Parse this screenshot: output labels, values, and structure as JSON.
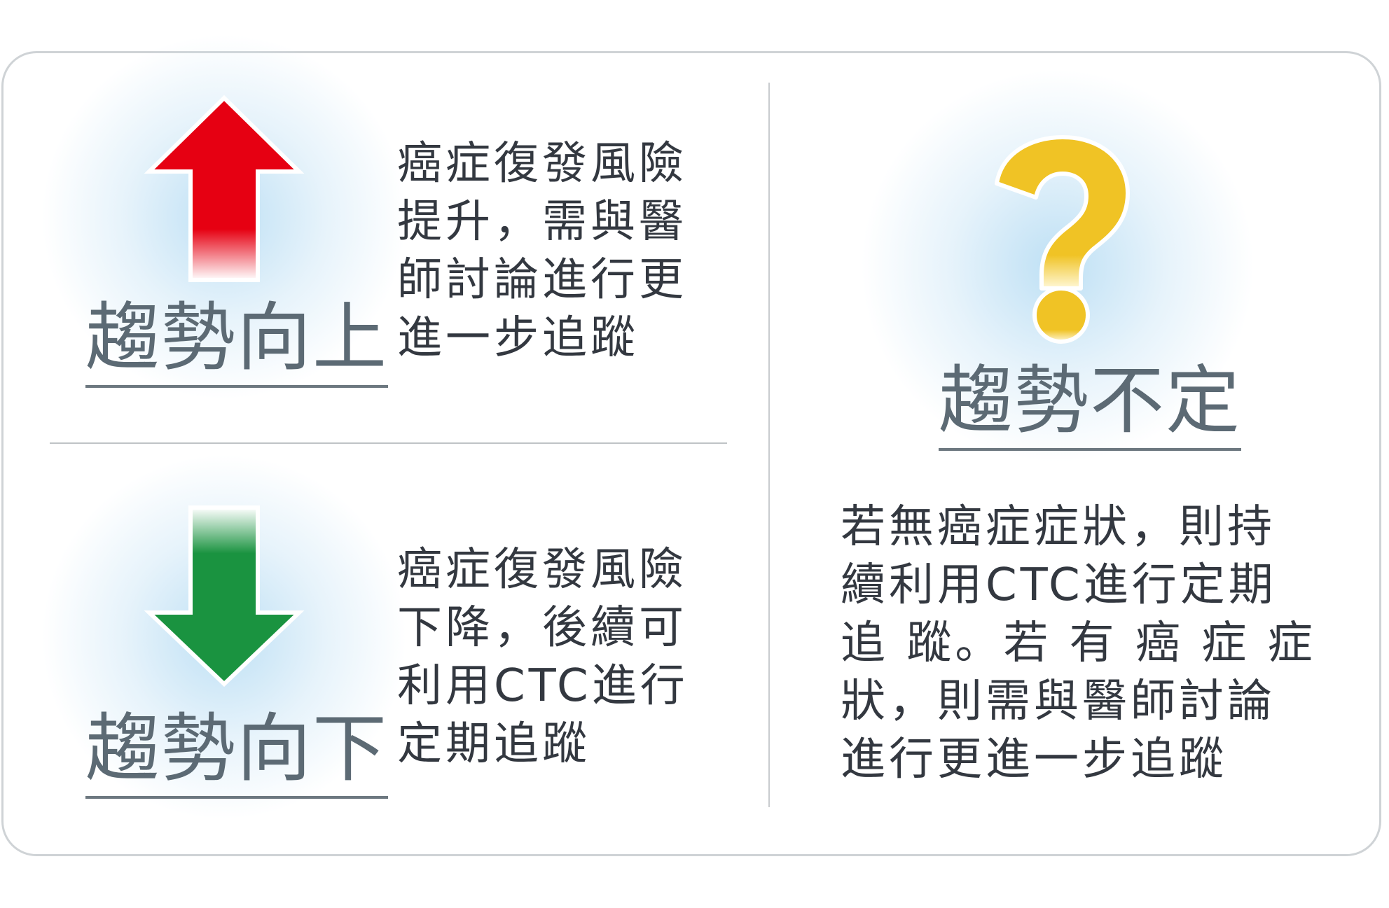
{
  "trend_up": {
    "label": "趨勢向上",
    "icon": "arrow-up-icon",
    "color": "#e60012",
    "description_lines": [
      "癌症復發風險",
      "提升，需與醫",
      "師討論進行更",
      "進一步追蹤"
    ]
  },
  "trend_down": {
    "label": "趨勢向下",
    "icon": "arrow-down-icon",
    "color": "#1a9340",
    "description_lines": [
      "癌症復發風險",
      "下降，後續可",
      "利用CTC進行",
      "定期追蹤"
    ]
  },
  "trend_uncertain": {
    "label": "趨勢不定",
    "icon": "question-mark-icon",
    "color": "#f0c325",
    "description_lines": [
      "若無癌症症狀，則持",
      "續利用CTC進行定期",
      "追 蹤。若 有 癌 症 症",
      "狀，則需與醫師討論",
      "進行更進一步追蹤"
    ]
  }
}
